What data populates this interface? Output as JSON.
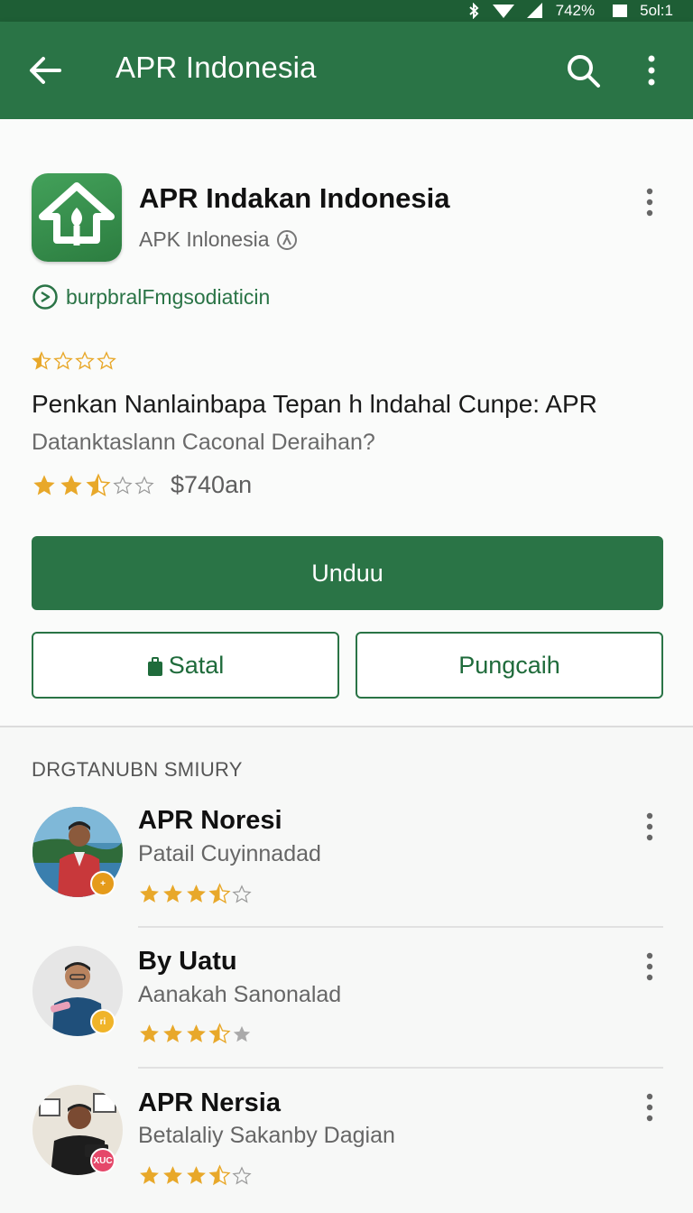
{
  "status_bar": {
    "signal_text": "742%",
    "time": "5ol:1"
  },
  "app_bar": {
    "title": "APR Indonesia"
  },
  "app": {
    "name": "APR Indakan Indonesia",
    "developer": "APK Inlonesia",
    "link_text": "burpbralFmgsodiaticin",
    "headline": "Penkan Nanlainbapa Tepan h lndahal Cunpe: APR",
    "subheadline": "Datanktaslann Caconal Deraihan?",
    "rating": 2.5,
    "price": "$740an",
    "primary_button": "Unduu",
    "secondary_button_left": "Satal",
    "secondary_button_right": "Pungcaih"
  },
  "reviews_section": {
    "title": "DRGTANUBN SMIURY",
    "items": [
      {
        "name": "APR Noresi",
        "subtitle": "Patail Cuyinnadad",
        "rating": 3.5,
        "badge": "+"
      },
      {
        "name": "By Uatu",
        "subtitle": "Aanakah Sanonalad",
        "rating": 3.5,
        "badge": "ri"
      },
      {
        "name": "APR Nersia",
        "subtitle": "Betalaliy Sakanby Dagian",
        "rating": 3.5,
        "badge": "XUC"
      }
    ]
  },
  "colors": {
    "primary": "#2a7446",
    "status_bar": "#1e5e35",
    "star": "#e8a82a"
  }
}
